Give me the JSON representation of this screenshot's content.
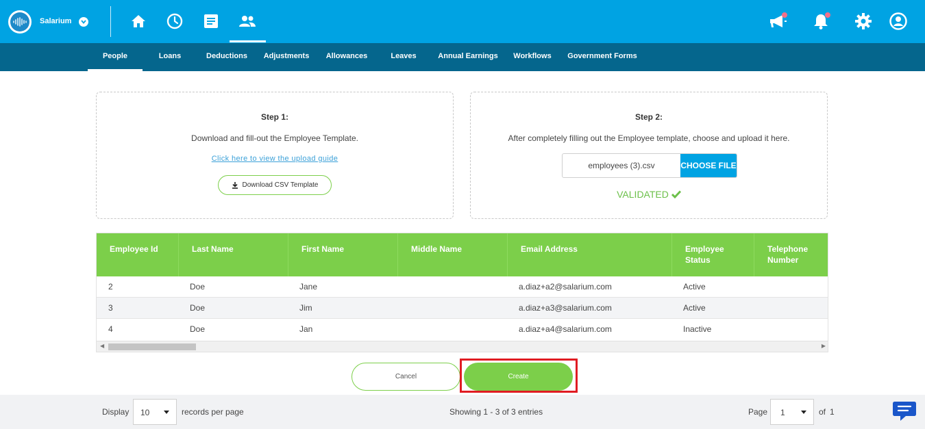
{
  "app": {
    "brand": "Salarium",
    "colors": {
      "primary": "#00a3e3",
      "secondary": "#05668d",
      "accent_green": "#7ccf4a",
      "highlight_red": "#e01b22",
      "notification_dot": "#f2708a"
    }
  },
  "topbar": {
    "nav_icons": [
      "home-icon",
      "clock-icon",
      "document-icon",
      "people-icon"
    ],
    "active_nav": "people-icon",
    "right_icons": [
      "megaphone-icon",
      "bell-icon",
      "gear-icon",
      "user-icon"
    ]
  },
  "subnav": {
    "tabs": [
      "People",
      "Loans",
      "Deductions",
      "Adjustments",
      "Allowances",
      "Leaves",
      "Annual Earnings",
      "Workflows",
      "Government Forms"
    ],
    "active": "People"
  },
  "step1": {
    "title": "Step 1:",
    "description": "Download and fill-out the Employee Template.",
    "guide_link": "Click here to view the upload guide",
    "download_label": "Download CSV Template"
  },
  "step2": {
    "title": "Step 2:",
    "description": "After completely filling out the Employee template, choose and upload it here.",
    "file_name": "employees (3).csv",
    "choose_label": "CHOOSE FILE",
    "status": "VALIDATED"
  },
  "table": {
    "columns": [
      {
        "line1": "Employee Id",
        "line2": ""
      },
      {
        "line1": "Last Name",
        "line2": ""
      },
      {
        "line1": "First Name",
        "line2": ""
      },
      {
        "line1": "Middle Name",
        "line2": ""
      },
      {
        "line1": "Email Address",
        "line2": ""
      },
      {
        "line1": "Employee",
        "line2": "Status"
      },
      {
        "line1": "Telephone",
        "line2": "Number"
      }
    ],
    "rows": [
      [
        "2",
        "Doe",
        "Jane",
        "",
        "a.diaz+a2@salarium.com",
        "Active",
        ""
      ],
      [
        "3",
        "Doe",
        "Jim",
        "",
        "a.diaz+a3@salarium.com",
        "Active",
        ""
      ],
      [
        "4",
        "Doe",
        "Jan",
        "",
        "a.diaz+a4@salarium.com",
        "Inactive",
        ""
      ]
    ]
  },
  "actions": {
    "cancel_label": "Cancel",
    "create_label": "Create"
  },
  "footer": {
    "display_label": "Display",
    "records_value": "10",
    "records_suffix": "records per page",
    "showing": "Showing 1 - 3 of 3 entries",
    "page_label": "Page",
    "page_value": "1",
    "of_label": "of",
    "total_pages": "1"
  }
}
